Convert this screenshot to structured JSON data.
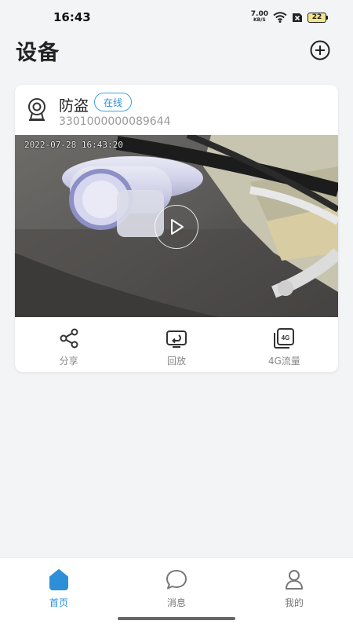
{
  "status_bar": {
    "time": "16:43",
    "net_speed_value": "7.00",
    "net_speed_unit": "KB/S",
    "battery_level": "22",
    "icons": [
      "wifi-icon",
      "sim-x-icon",
      "battery-icon"
    ]
  },
  "header": {
    "title": "设备",
    "add_icon": "plus-circle-icon"
  },
  "device_card": {
    "name": "防盗",
    "status": "在线",
    "device_id": "3301000000089644",
    "camera_icon": "camera-icon",
    "video": {
      "timestamp": "2022-07-28 16:43:20",
      "play_icon": "play-icon"
    },
    "actions": [
      {
        "label": "分享",
        "icon": "share-icon"
      },
      {
        "label": "回放",
        "icon": "playback-icon"
      },
      {
        "label": "4G流量",
        "icon": "4g-data-icon",
        "icon_text": "4G"
      }
    ]
  },
  "bottom_nav": {
    "items": [
      {
        "label": "首页",
        "icon": "home-icon",
        "active": true
      },
      {
        "label": "消息",
        "icon": "message-icon",
        "active": false
      },
      {
        "label": "我的",
        "icon": "profile-icon",
        "active": false
      }
    ]
  },
  "colors": {
    "accent": "#2d8fd8",
    "badge_border": "#3aa3e6",
    "background": "#f3f4f6",
    "battery_fill": "#f4e58a"
  }
}
